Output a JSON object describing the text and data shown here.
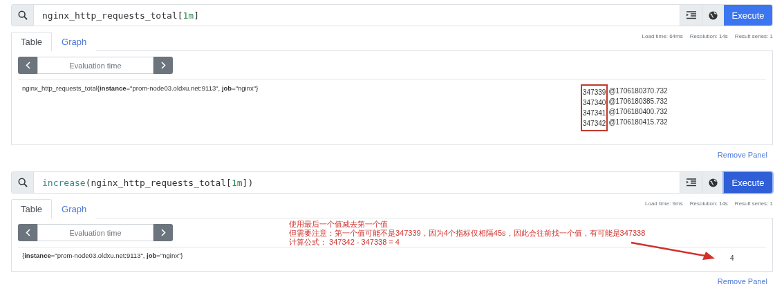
{
  "panels": [
    {
      "query": [
        {
          "text": "nginx_http_requests_total[",
          "kind": "plain"
        },
        {
          "text": "1m",
          "kind": "number"
        },
        {
          "text": "]",
          "kind": "plain"
        }
      ],
      "execute": {
        "label": "Execute",
        "focused": false
      },
      "stats": [
        "Load time: 64ms",
        "Resolution: 14s",
        "Result series: 1"
      ],
      "tabs": [
        {
          "label": "Table",
          "selected": true
        },
        {
          "label": "Graph",
          "selected": false
        }
      ],
      "evaluation": {
        "placeholder": "Evaluation time"
      },
      "rows": [
        {
          "series": "nginx_http_requests_total{**instance**=\"prom-node03.oldxu.net:9113\", **job**=\"nginx\"}",
          "highlighted": true,
          "values": [
            {
              "value": "347339",
              "time": "@1706180370.732"
            },
            {
              "value": "347340",
              "time": "@1706180385.732"
            },
            {
              "value": "347341",
              "time": "@1706180400.732"
            },
            {
              "value": "347342",
              "time": "@1706180415.732"
            }
          ]
        }
      ],
      "remove": "Remove Panel"
    },
    {
      "query": [
        {
          "text": "increase",
          "kind": "function"
        },
        {
          "text": "(nginx_http_requests_total[",
          "kind": "plain"
        },
        {
          "text": "1m",
          "kind": "number"
        },
        {
          "text": "])",
          "kind": "plain"
        }
      ],
      "execute": {
        "label": "Execute",
        "focused": true
      },
      "stats": [
        "Load time: 9ms",
        "Resolution: 14s",
        "Result series: 1"
      ],
      "tabs": [
        {
          "label": "Table",
          "selected": true
        },
        {
          "label": "Graph",
          "selected": false
        }
      ],
      "evaluation": {
        "placeholder": "Evaluation time"
      },
      "rows": [
        {
          "series": "{**instance**=\"prom-node03.oldxu.net:9113\", **job**=\"nginx\"}",
          "values": [
            {
              "value": "4"
            }
          ]
        }
      ],
      "annotation": [
        "使用最后一个值减去第一个值",
        "但需要注意：第一个值可能不是347339，因为4个指标仅相隔45s，因此会往前找一个值，有可能是347338",
        "计算公式： 347342 - 347338 = 4"
      ],
      "remove": "Remove Panel"
    }
  ]
}
